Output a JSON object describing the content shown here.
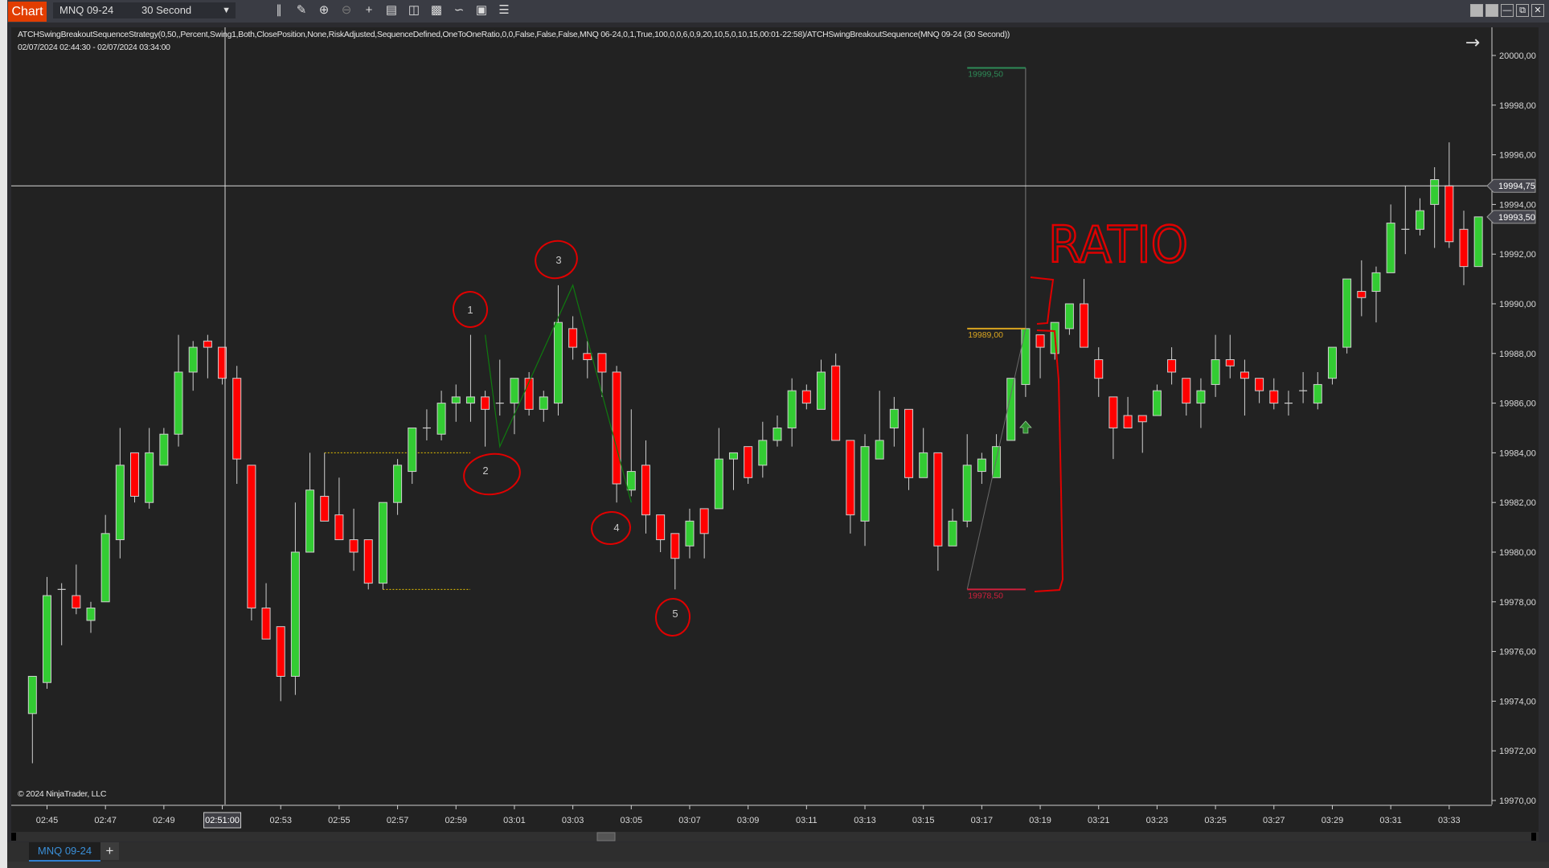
{
  "toolbar": {
    "chart_label": "Chart",
    "instrument": "MNQ 09-24",
    "interval": "30 Second",
    "icons": [
      "bar-type-icon",
      "drawing-tool-icon",
      "zoom-in-icon",
      "zoom-out-icon",
      "crosshair-icon",
      "data-box-icon",
      "chart-trader-icon",
      "properties-icon",
      "strategies-icon",
      "indicators-list-icon"
    ]
  },
  "chart": {
    "strategy_label": "ATCHSwingBreakoutSequenceStrategy(0,50,,Percent,Swing1,Both,ClosePosition,None,RiskAdjusted,SequenceDefined,OneToOneRatio,0,0,False,False,False,MNQ 06-24,0,1,True,100,0,0,6,0,9,20,10,5,0,10,15,00:01-22:58)/ATCHSwingBreakoutSequence(MNQ 09-24 (30 Second))",
    "date_range": "02/07/2024 02:44:30 - 02/07/2024 03:34:00",
    "copyright": "© 2024 NinjaTrader, LLC",
    "crosshair_price": "19994,75",
    "crosshair_time": "02:51:00",
    "last_price": "19993,50",
    "target_label": "19999,50",
    "entry_label": "19989,00",
    "stop_label": "19978,50",
    "annotation_text": "RATIO",
    "swing_labels": [
      "1",
      "2",
      "3",
      "4",
      "5"
    ],
    "colors": {
      "up": "#33cc33",
      "down": "#ff0000",
      "wick": "#cfcfcf",
      "target": "#2e8b57",
      "entry": "#d9a520",
      "stop": "#d0203c",
      "annotation": "#e00000",
      "swing_line": "#0f7a0f",
      "level_line": "#e6c200"
    }
  },
  "chart_data": {
    "type": "candlestick",
    "instrument": "MNQ 09-24",
    "interval": "30 Second",
    "ylim": [
      19970,
      20000
    ],
    "y_ticks": [
      "20000,00",
      "19998,00",
      "19996,00",
      "19994,00",
      "19992,00",
      "19990,00",
      "19988,00",
      "19986,00",
      "19984,00",
      "19982,00",
      "19980,00",
      "19978,00",
      "19976,00",
      "19974,00",
      "19972,00",
      "19970,00"
    ],
    "x_ticks": [
      "02:45",
      "02:47",
      "02:49",
      "02:51",
      "02:53",
      "02:55",
      "02:57",
      "02:59",
      "03:01",
      "03:03",
      "03:05",
      "03:07",
      "03:09",
      "03:11",
      "03:13",
      "03:15",
      "03:17",
      "03:19",
      "03:21",
      "03:23",
      "03:25",
      "03:27",
      "03:29",
      "03:31",
      "03:33"
    ],
    "ohlc_fields": [
      "open",
      "high",
      "low",
      "close"
    ],
    "ohlc": [
      [
        19973.5,
        19975,
        19971.5,
        19975
      ],
      [
        19974.75,
        19979,
        19974.5,
        19978.25
      ],
      [
        19978.5,
        19978.75,
        19976.25,
        19978.5
      ],
      [
        19978.25,
        19979.5,
        19977.5,
        19977.75
      ],
      [
        19977.25,
        19978,
        19976.75,
        19977.75
      ],
      [
        19978,
        19981.5,
        19978,
        19980.75
      ],
      [
        19980.5,
        19985,
        19979.75,
        19983.5
      ],
      [
        19984,
        19984,
        19982,
        19982.25
      ],
      [
        19982,
        19985,
        19981.75,
        19984
      ],
      [
        19983.5,
        19985,
        19983.5,
        19984.75
      ],
      [
        19984.75,
        19988.75,
        19984.25,
        19987.25
      ],
      [
        19987.25,
        19988.5,
        19986.5,
        19988.25
      ],
      [
        19988.5,
        19988.75,
        19987,
        19988.25
      ],
      [
        19988.25,
        19988.25,
        19986.75,
        19987
      ],
      [
        19987,
        19987.5,
        19982.75,
        19983.75
      ],
      [
        19983.5,
        19983.5,
        19977.25,
        19977.75
      ],
      [
        19977.75,
        19978.75,
        19976.5,
        19976.5
      ],
      [
        19977,
        19977,
        19974,
        19975
      ],
      [
        19975,
        19982,
        19974.25,
        19980
      ],
      [
        19980,
        19984,
        19980,
        19982.5
      ],
      [
        19982.25,
        19984,
        19981.25,
        19981.25
      ],
      [
        19981.5,
        19983,
        19980.5,
        19980.5
      ],
      [
        19980.5,
        19981.75,
        19979.25,
        19980
      ],
      [
        19980.5,
        19980.5,
        19978.5,
        19978.75
      ],
      [
        19978.75,
        19982,
        19978.5,
        19982
      ],
      [
        19982,
        19983.75,
        19981.5,
        19983.5
      ],
      [
        19983.25,
        19985,
        19982.75,
        19985
      ],
      [
        19985,
        19985.75,
        19984.5,
        19985
      ],
      [
        19984.75,
        19986.5,
        19984.5,
        19986
      ],
      [
        19986,
        19986.75,
        19985.25,
        19986.25
      ],
      [
        19986,
        19988.75,
        19985.25,
        19986.25
      ],
      [
        19986.25,
        19986.5,
        19984.25,
        19985.75
      ],
      [
        19986,
        19987.75,
        19985.5,
        19986
      ],
      [
        19986,
        19987,
        19984.75,
        19987
      ],
      [
        19987,
        19987.25,
        19985.5,
        19985.75
      ],
      [
        19985.75,
        19986.5,
        19985.25,
        19986.25
      ],
      [
        19986,
        19990.75,
        19985.5,
        19989.25
      ],
      [
        19989,
        19989.5,
        19987.75,
        19988.25
      ],
      [
        19988,
        19988.5,
        19987,
        19987.75
      ],
      [
        19988,
        19988,
        19986.25,
        19987.25
      ],
      [
        19987.25,
        19987.5,
        19982,
        19982.75
      ],
      [
        19982.5,
        19985.75,
        19982.25,
        19983.25
      ],
      [
        19983.5,
        19984.5,
        19980.75,
        19981.5
      ],
      [
        19981.5,
        19981.5,
        19980,
        19980.5
      ],
      [
        19980.75,
        19980.75,
        19978.5,
        19979.75
      ],
      [
        19980.25,
        19981.75,
        19979.75,
        19981.25
      ],
      [
        19981.75,
        19981.75,
        19979.75,
        19980.75
      ],
      [
        19981.75,
        19985,
        19981.75,
        19983.75
      ],
      [
        19983.75,
        19984,
        19982.5,
        19984
      ],
      [
        19984.25,
        19984.25,
        19982.75,
        19983
      ],
      [
        19983.5,
        19985.25,
        19983,
        19984.5
      ],
      [
        19984.5,
        19985.5,
        19984.25,
        19985
      ],
      [
        19985,
        19987,
        19984.25,
        19986.5
      ],
      [
        19986.5,
        19986.75,
        19985.75,
        19986
      ],
      [
        19985.75,
        19987.75,
        19985.75,
        19987.25
      ],
      [
        19987.5,
        19988,
        19984.5,
        19984.5
      ],
      [
        19984.5,
        19984.5,
        19980.75,
        19981.5
      ],
      [
        19981.25,
        19984.75,
        19980.25,
        19984.25
      ],
      [
        19983.75,
        19986.5,
        19983.75,
        19984.5
      ],
      [
        19985,
        19986.25,
        19984.25,
        19985.75
      ],
      [
        19985.75,
        19985.75,
        19982.5,
        19983
      ],
      [
        19983,
        19985,
        19983,
        19984
      ],
      [
        19984,
        19984,
        19979.25,
        19980.25
      ],
      [
        19980.25,
        19981.75,
        19980.25,
        19981.25
      ],
      [
        19981.25,
        19984.75,
        19981,
        19983.5
      ],
      [
        19983.25,
        19984,
        19982.75,
        19983.75
      ],
      [
        19983,
        19984.75,
        19983,
        19984.25
      ],
      [
        19984.5,
        19987,
        19984.5,
        19987
      ],
      [
        19986.75,
        19989,
        19986.25,
        19989
      ],
      [
        19988.75,
        19988.75,
        19987,
        19988.25
      ],
      [
        19988,
        19989.25,
        19987.75,
        19989.25
      ],
      [
        19989,
        19990,
        19988.75,
        19990
      ],
      [
        19990,
        19991,
        19988.25,
        19988.25
      ],
      [
        19987.75,
        19988.25,
        19986.25,
        19987
      ],
      [
        19986.25,
        19986.25,
        19983.75,
        19985
      ],
      [
        19985.5,
        19986.25,
        19985,
        19985
      ],
      [
        19985.5,
        19985.5,
        19984,
        19985.25
      ],
      [
        19985.5,
        19986.75,
        19985.5,
        19986.5
      ],
      [
        19987.75,
        19988.25,
        19986.75,
        19987.25
      ],
      [
        19987,
        19987,
        19985.5,
        19986
      ],
      [
        19986,
        19987,
        19985,
        19986.5
      ],
      [
        19986.75,
        19988.75,
        19986.25,
        19987.75
      ],
      [
        19987.75,
        19988.75,
        19987,
        19987.5
      ],
      [
        19987.25,
        19987.75,
        19985.5,
        19987
      ],
      [
        19987,
        19987,
        19986,
        19986.5
      ],
      [
        19986.5,
        19987,
        19985.75,
        19986
      ],
      [
        19986,
        19986.5,
        19985.5,
        19986
      ],
      [
        19986.5,
        19987.25,
        19986,
        19986.5
      ],
      [
        19986,
        19987.25,
        19985.75,
        19986.75
      ],
      [
        19987,
        19988.25,
        19986.75,
        19988.25
      ],
      [
        19988.25,
        19991,
        19988,
        19991
      ],
      [
        19990.5,
        19991.75,
        19989.5,
        19990.25
      ],
      [
        19990.5,
        19991.5,
        19989.25,
        19991.25
      ],
      [
        19991.25,
        19994,
        19991.25,
        19993.25
      ],
      [
        19993,
        19994.75,
        19992,
        19993
      ],
      [
        19993,
        19994.25,
        19992.75,
        19993.75
      ],
      [
        19994,
        19995.5,
        19992.25,
        19995
      ],
      [
        19994.75,
        19996.5,
        19992.25,
        19992.5
      ],
      [
        19993,
        19993.75,
        19990.75,
        19991.5
      ],
      [
        19991.5,
        19993.5,
        19991.5,
        19993.5
      ]
    ],
    "crosshair_price": 19994.75,
    "last_price": 19993.5,
    "trade": {
      "target": 19999.5,
      "entry": 19989.0,
      "stop": 19978.5
    },
    "levels": [
      19984.0,
      19978.5
    ],
    "swing_points": [
      19988.75,
      19984.25,
      19990.75,
      19982.0
    ]
  },
  "tabs": {
    "active": "MNQ 09-24",
    "add_label": "+"
  }
}
